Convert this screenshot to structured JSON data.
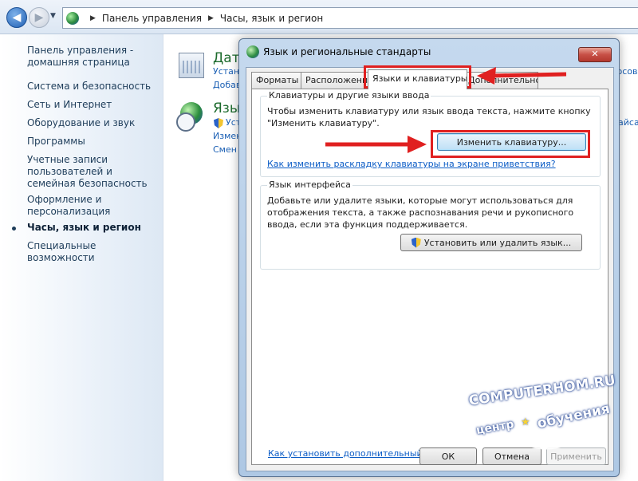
{
  "address_bar": {
    "breadcrumbs": [
      "Панель управления",
      "Часы, язык и регион"
    ]
  },
  "sidebar": {
    "items": [
      {
        "label": "Панель управления - домашняя страница"
      },
      {
        "label": "Система и безопасность"
      },
      {
        "label": "Сеть и Интернет"
      },
      {
        "label": "Оборудование и звук"
      },
      {
        "label": "Программы"
      },
      {
        "label": "Учетные записи пользователей и семейная безопасность"
      },
      {
        "label": "Оформление и персонализация"
      },
      {
        "label": "Часы, язык и регион",
        "active": true
      },
      {
        "label": "Специальные возможности"
      }
    ]
  },
  "background": {
    "cat1_title": "Дата",
    "cat1_links": [
      "Устан",
      "Добав"
    ],
    "cat2_title": "Язык",
    "cat2_links": [
      "Уст",
      "Измен",
      "Смен"
    ],
    "right_fragments": [
      "юсов",
      "айса"
    ]
  },
  "dialog": {
    "title": "Язык и региональные стандарты",
    "close": "✕",
    "tabs": [
      {
        "label": "Форматы"
      },
      {
        "label": "Расположение"
      },
      {
        "label": "Языки и клавиатуры",
        "active": true
      },
      {
        "label": "Дополнительно"
      }
    ],
    "keyboards_group": {
      "label": "Клавиатуры и другие языки ввода",
      "text_line1": "Чтобы изменить клавиатуру или язык ввода текста, нажмите кнопку",
      "text_line2": "\"Изменить клавиатуру\".",
      "button": "Изменить клавиатуру...",
      "link": "Как изменить раскладку клавиатуры на экране приветствия?"
    },
    "interface_group": {
      "label": "Язык интерфейса",
      "text_line1": "Добавьте или удалите языки, которые могут использоваться для",
      "text_line2": "отображения текста, а также распознавания речи и рукописного",
      "text_line3": "ввода, если эта функция поддерживается.",
      "button": "Установить или удалить язык..."
    },
    "bottom_link": "Как установить дополнительный язык?",
    "buttons": {
      "ok": "ОК",
      "cancel": "Отмена",
      "apply": "Применить"
    }
  },
  "watermark": {
    "line1": "COMPUTERHOM.RU",
    "line2_left": "центр",
    "line2_right": "обучения"
  },
  "colors": {
    "highlight": "#e02020",
    "link": "#0b5cc6",
    "category": "#1d6b2d"
  }
}
